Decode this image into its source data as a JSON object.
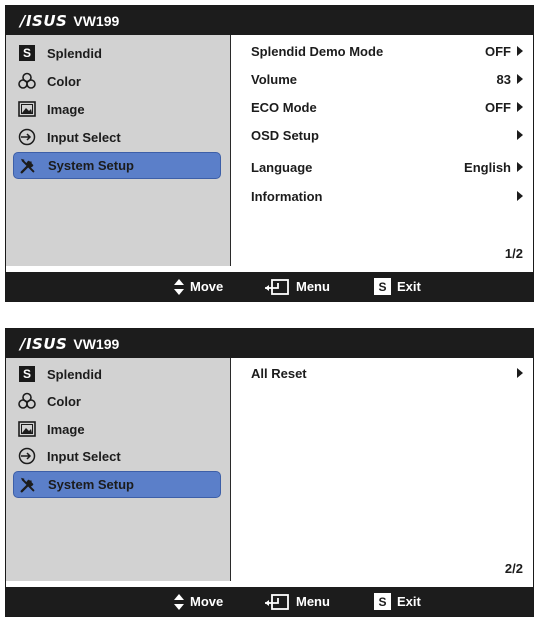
{
  "panels": [
    {
      "header": {
        "logo": "/ISUS",
        "model": "VW199"
      },
      "menu": [
        {
          "label": "Splendid",
          "icon": "splendid-s-icon"
        },
        {
          "label": "Color",
          "icon": "color-circles-icon"
        },
        {
          "label": "Image",
          "icon": "image-icon"
        },
        {
          "label": "Input Select",
          "icon": "input-select-icon"
        },
        {
          "label": "System Setup",
          "icon": "wrench-screwdriver-icon",
          "active": true
        }
      ],
      "options": [
        {
          "label": "Splendid Demo Mode",
          "value": "OFF"
        },
        {
          "label": "Volume",
          "value": "83"
        },
        {
          "label": "ECO Mode",
          "value": "OFF"
        },
        {
          "label": "OSD Setup",
          "value": ""
        },
        {
          "label": "Language",
          "value": "English"
        },
        {
          "label": "Information",
          "value": ""
        }
      ],
      "page": "1/2",
      "footer": {
        "move": "Move",
        "menu": "Menu",
        "exit": "Exit",
        "exit_key": "S"
      }
    },
    {
      "header": {
        "logo": "/ISUS",
        "model": "VW199"
      },
      "menu": [
        {
          "label": "Splendid",
          "icon": "splendid-s-icon"
        },
        {
          "label": "Color",
          "icon": "color-circles-icon"
        },
        {
          "label": "Image",
          "icon": "image-icon"
        },
        {
          "label": "Input Select",
          "icon": "input-select-icon"
        },
        {
          "label": "System Setup",
          "icon": "wrench-screwdriver-icon",
          "active": true
        }
      ],
      "options": [
        {
          "label": "All Reset",
          "value": ""
        }
      ],
      "page": "2/2",
      "footer": {
        "move": "Move",
        "menu": "Menu",
        "exit": "Exit",
        "exit_key": "S"
      }
    }
  ],
  "colors": {
    "bar": "#1c1c1c",
    "sidebar": "#d2d2d2",
    "active": "#5b7fc9"
  }
}
